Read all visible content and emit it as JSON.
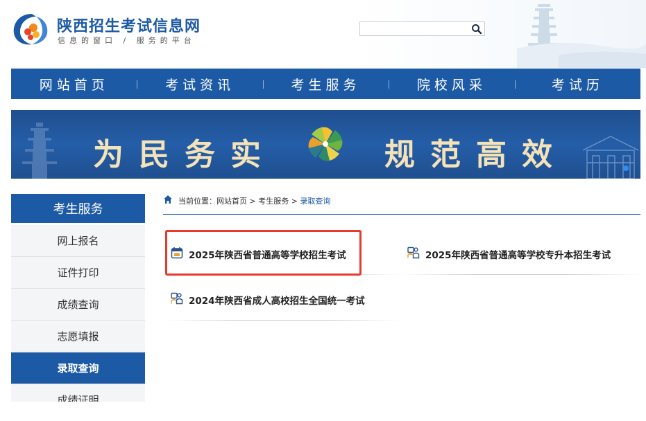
{
  "header": {
    "title": "陕西招生考试信息网",
    "slogan": "信息的窗口 / 服务的平台",
    "search": {
      "value": "",
      "placeholder": ""
    }
  },
  "nav": {
    "items": [
      "网站首页",
      "考试资讯",
      "考生服务",
      "院校风采",
      "考试历"
    ]
  },
  "banner": {
    "left_text": "为民务实",
    "right_text": "规范高效"
  },
  "sidebar": {
    "title": "考生服务",
    "items": [
      {
        "label": "网上报名",
        "active": false
      },
      {
        "label": "证件打印",
        "active": false
      },
      {
        "label": "成绩查询",
        "active": false
      },
      {
        "label": "志愿填报",
        "active": false
      },
      {
        "label": "录取查询",
        "active": true
      },
      {
        "label": "成绩证明",
        "active": false
      }
    ]
  },
  "breadcrumb": {
    "prefix": "当前位置：",
    "home": "网站首页",
    "sep": " > ",
    "section": "考生服务",
    "current": "录取查询"
  },
  "exams": [
    {
      "label": "2025年陕西省普通高等学校招生考试",
      "icon": "calendar-icon",
      "highlighted": true
    },
    {
      "label": "2025年陕西省普通高等学校专升本招生考试",
      "icon": "students-icon",
      "highlighted": false
    },
    {
      "label": "2024年陕西省成人高校招生全国统一考试",
      "icon": "students-icon",
      "highlighted": false
    }
  ],
  "colors": {
    "primary": "#1d5aa6",
    "highlight": "#e53a2d",
    "banner_text": "#f4e2b8"
  }
}
